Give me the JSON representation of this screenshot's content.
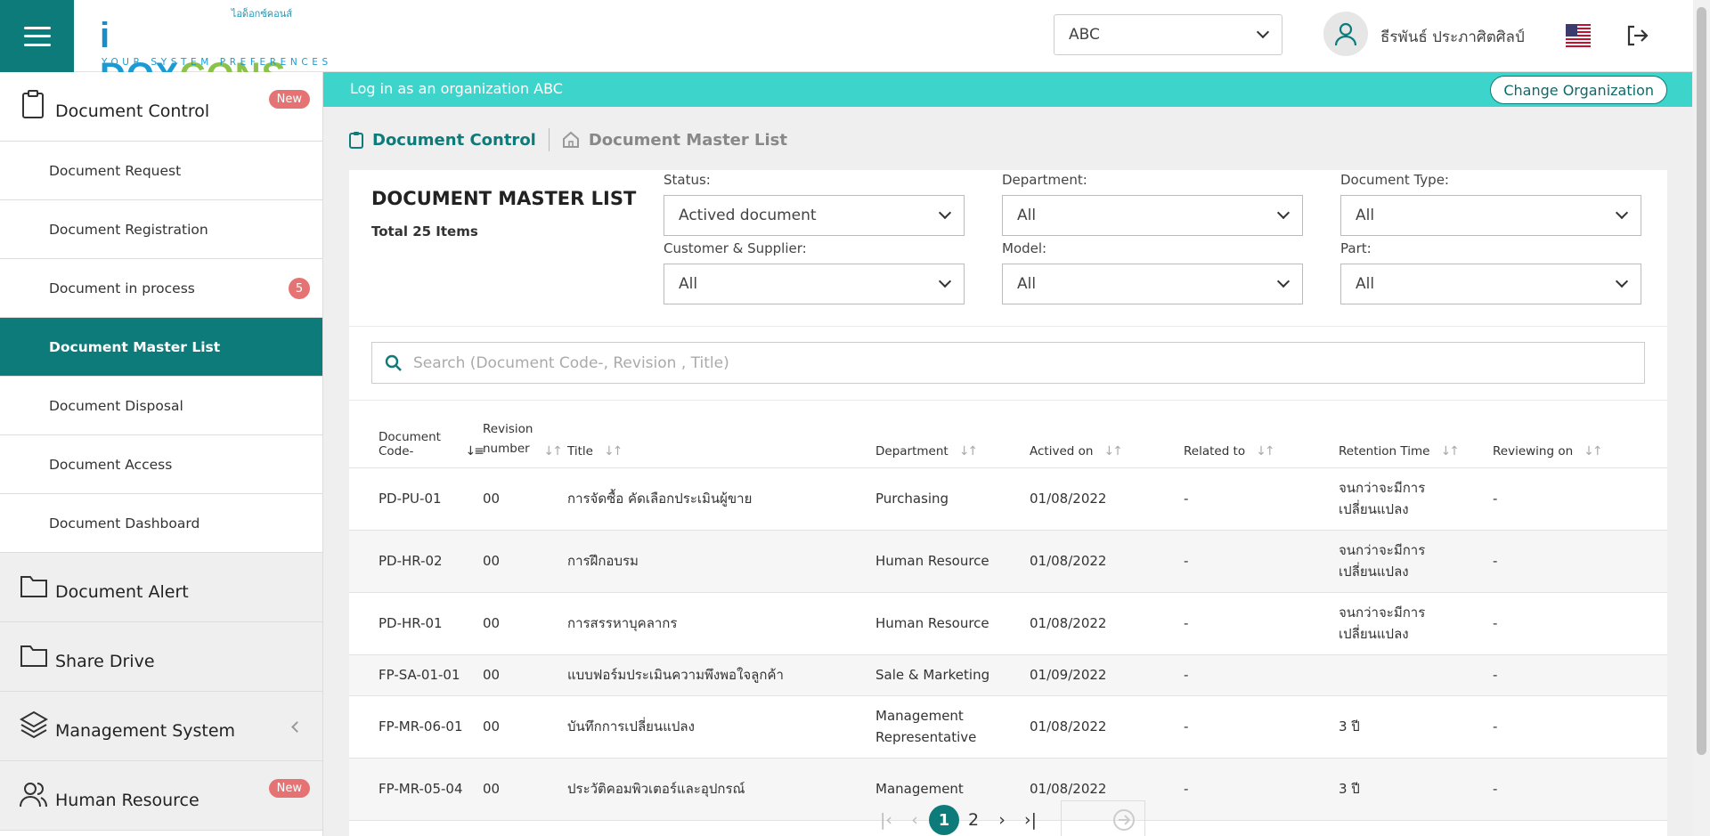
{
  "header": {
    "logo_thai": "ไอด็อกซ์คอนส์",
    "logo_i": "i",
    "logo_dox": "DOX",
    "logo_cons": "CONS",
    "logo_tagline": "YOUR SYSTEM PREFERENCES",
    "org_select_value": "ABC",
    "user_name": "ธีรพันธ์ ประภาศิตศิลป์"
  },
  "sidebar": {
    "document_control": {
      "label": "Document Control",
      "badge": "New"
    },
    "items": [
      {
        "label": "Document Request"
      },
      {
        "label": "Document Registration"
      },
      {
        "label": "Document in process",
        "count": "5"
      },
      {
        "label": "Document Master List"
      },
      {
        "label": "Document Disposal"
      },
      {
        "label": "Document Access"
      },
      {
        "label": "Document Dashboard"
      }
    ],
    "document_alert": {
      "label": "Document Alert"
    },
    "share_drive": {
      "label": "Share Drive"
    },
    "management_system": {
      "label": "Management System"
    },
    "human_resource": {
      "label": "Human Resource",
      "badge": "New"
    }
  },
  "banner": {
    "text": "Log in as an organization ABC",
    "change_button": "Change Organization"
  },
  "breadcrumb": {
    "root": "Document Control",
    "current": "Document Master List"
  },
  "list": {
    "title": "DOCUMENT MASTER LIST",
    "total": "Total 25 Items",
    "filters": {
      "status": {
        "label": "Status:",
        "value": "Actived document"
      },
      "department": {
        "label": "Department:",
        "value": "All"
      },
      "document_type": {
        "label": "Document Type:",
        "value": "All"
      },
      "customer_supplier": {
        "label": "Customer & Supplier:",
        "value": "All"
      },
      "model": {
        "label": "Model:",
        "value": "All"
      },
      "part": {
        "label": "Part:",
        "value": "All"
      }
    },
    "search_placeholder": "Search (Document Code-, Revision , Title)",
    "columns": {
      "code": "Document Code-",
      "revision_1": "Revision",
      "revision_2": "number",
      "title": "Title",
      "department": "Department",
      "actived": "Actived on",
      "related": "Related to",
      "retention": "Retention Time",
      "reviewing": "Reviewing on"
    },
    "rows": [
      {
        "code": "PD-PU-01",
        "revision": "00",
        "title": "การจัดซื้อ คัดเลือกประเมินผู้ขาย",
        "department": "Purchasing",
        "actived": "01/08/2022",
        "related": "-",
        "retention": "จนกว่าจะมีการเปลี่ยนแปลง",
        "reviewing": "-"
      },
      {
        "code": "PD-HR-02",
        "revision": "00",
        "title": "การฝึกอบรม",
        "department": "Human Resource",
        "actived": "01/08/2022",
        "related": "-",
        "retention": "จนกว่าจะมีการเปลี่ยนแปลง",
        "reviewing": "-"
      },
      {
        "code": "PD-HR-01",
        "revision": "00",
        "title": "การสรรหาบุคลากร",
        "department": "Human Resource",
        "actived": "01/08/2022",
        "related": "-",
        "retention": "จนกว่าจะมีการเปลี่ยนแปลง",
        "reviewing": "-"
      },
      {
        "code": "FP-SA-01-01",
        "revision": "00",
        "title": "แบบฟอร์มประเมินความพึงพอใจลูกค้า",
        "department": "Sale & Marketing",
        "actived": "01/09/2022",
        "related": "-",
        "retention": "",
        "reviewing": "-"
      },
      {
        "code": "FP-MR-06-01",
        "revision": "00",
        "title": "บันทึกการเปลี่ยนแปลง",
        "department": "Management Representative",
        "actived": "01/08/2022",
        "related": "-",
        "retention": "3 ปี",
        "reviewing": "-"
      },
      {
        "code": "FP-MR-05-04",
        "revision": "00",
        "title": "ประวัติคอมพิวเตอร์และอุปกรณ์",
        "department": "Management",
        "actived": "01/08/2022",
        "related": "-",
        "retention": "3 ปี",
        "reviewing": "-"
      }
    ]
  },
  "pagination": {
    "current": "1",
    "next_page": "2"
  }
}
